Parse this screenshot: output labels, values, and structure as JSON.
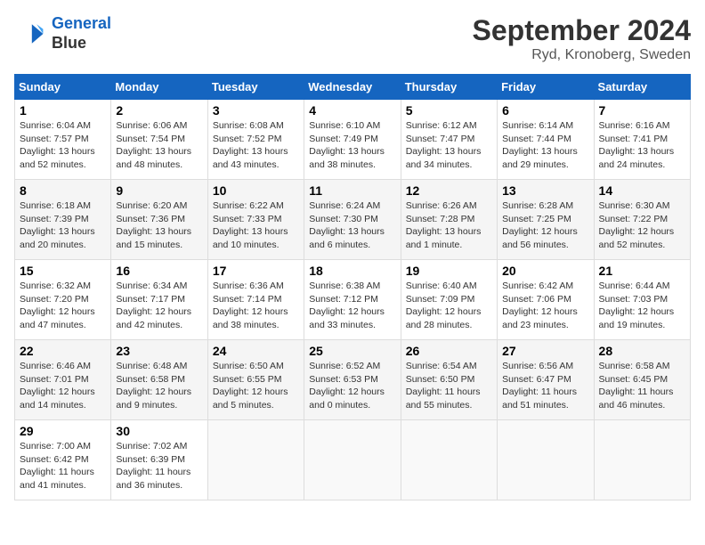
{
  "header": {
    "logo_line1": "General",
    "logo_line2": "Blue",
    "month": "September 2024",
    "location": "Ryd, Kronoberg, Sweden"
  },
  "days_of_week": [
    "Sunday",
    "Monday",
    "Tuesday",
    "Wednesday",
    "Thursday",
    "Friday",
    "Saturday"
  ],
  "weeks": [
    [
      {
        "day": "1",
        "rise": "6:04 AM",
        "set": "7:57 PM",
        "daylight": "13 hours and 52 minutes."
      },
      {
        "day": "2",
        "rise": "6:06 AM",
        "set": "7:54 PM",
        "daylight": "13 hours and 48 minutes."
      },
      {
        "day": "3",
        "rise": "6:08 AM",
        "set": "7:52 PM",
        "daylight": "13 hours and 43 minutes."
      },
      {
        "day": "4",
        "rise": "6:10 AM",
        "set": "7:49 PM",
        "daylight": "13 hours and 38 minutes."
      },
      {
        "day": "5",
        "rise": "6:12 AM",
        "set": "7:47 PM",
        "daylight": "13 hours and 34 minutes."
      },
      {
        "day": "6",
        "rise": "6:14 AM",
        "set": "7:44 PM",
        "daylight": "13 hours and 29 minutes."
      },
      {
        "day": "7",
        "rise": "6:16 AM",
        "set": "7:41 PM",
        "daylight": "13 hours and 24 minutes."
      }
    ],
    [
      {
        "day": "8",
        "rise": "6:18 AM",
        "set": "7:39 PM",
        "daylight": "13 hours and 20 minutes."
      },
      {
        "day": "9",
        "rise": "6:20 AM",
        "set": "7:36 PM",
        "daylight": "13 hours and 15 minutes."
      },
      {
        "day": "10",
        "rise": "6:22 AM",
        "set": "7:33 PM",
        "daylight": "13 hours and 10 minutes."
      },
      {
        "day": "11",
        "rise": "6:24 AM",
        "set": "7:30 PM",
        "daylight": "13 hours and 6 minutes."
      },
      {
        "day": "12",
        "rise": "6:26 AM",
        "set": "7:28 PM",
        "daylight": "13 hours and 1 minute."
      },
      {
        "day": "13",
        "rise": "6:28 AM",
        "set": "7:25 PM",
        "daylight": "12 hours and 56 minutes."
      },
      {
        "day": "14",
        "rise": "6:30 AM",
        "set": "7:22 PM",
        "daylight": "12 hours and 52 minutes."
      }
    ],
    [
      {
        "day": "15",
        "rise": "6:32 AM",
        "set": "7:20 PM",
        "daylight": "12 hours and 47 minutes."
      },
      {
        "day": "16",
        "rise": "6:34 AM",
        "set": "7:17 PM",
        "daylight": "12 hours and 42 minutes."
      },
      {
        "day": "17",
        "rise": "6:36 AM",
        "set": "7:14 PM",
        "daylight": "12 hours and 38 minutes."
      },
      {
        "day": "18",
        "rise": "6:38 AM",
        "set": "7:12 PM",
        "daylight": "12 hours and 33 minutes."
      },
      {
        "day": "19",
        "rise": "6:40 AM",
        "set": "7:09 PM",
        "daylight": "12 hours and 28 minutes."
      },
      {
        "day": "20",
        "rise": "6:42 AM",
        "set": "7:06 PM",
        "daylight": "12 hours and 23 minutes."
      },
      {
        "day": "21",
        "rise": "6:44 AM",
        "set": "7:03 PM",
        "daylight": "12 hours and 19 minutes."
      }
    ],
    [
      {
        "day": "22",
        "rise": "6:46 AM",
        "set": "7:01 PM",
        "daylight": "12 hours and 14 minutes."
      },
      {
        "day": "23",
        "rise": "6:48 AM",
        "set": "6:58 PM",
        "daylight": "12 hours and 9 minutes."
      },
      {
        "day": "24",
        "rise": "6:50 AM",
        "set": "6:55 PM",
        "daylight": "12 hours and 5 minutes."
      },
      {
        "day": "25",
        "rise": "6:52 AM",
        "set": "6:53 PM",
        "daylight": "12 hours and 0 minutes."
      },
      {
        "day": "26",
        "rise": "6:54 AM",
        "set": "6:50 PM",
        "daylight": "11 hours and 55 minutes."
      },
      {
        "day": "27",
        "rise": "6:56 AM",
        "set": "6:47 PM",
        "daylight": "11 hours and 51 minutes."
      },
      {
        "day": "28",
        "rise": "6:58 AM",
        "set": "6:45 PM",
        "daylight": "11 hours and 46 minutes."
      }
    ],
    [
      {
        "day": "29",
        "rise": "7:00 AM",
        "set": "6:42 PM",
        "daylight": "11 hours and 41 minutes."
      },
      {
        "day": "30",
        "rise": "7:02 AM",
        "set": "6:39 PM",
        "daylight": "11 hours and 36 minutes."
      },
      null,
      null,
      null,
      null,
      null
    ]
  ]
}
